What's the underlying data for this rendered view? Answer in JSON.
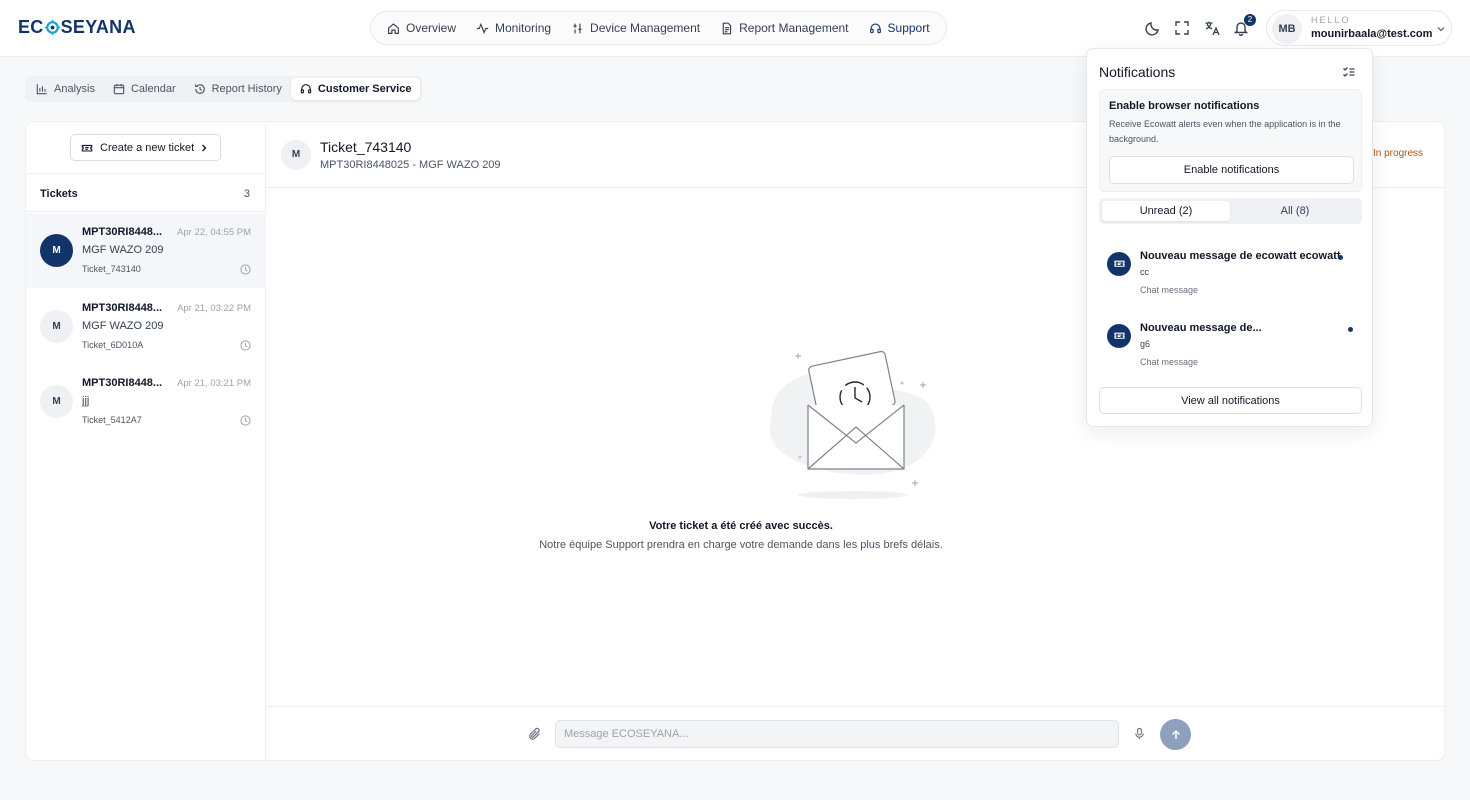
{
  "header": {
    "logo": {
      "part1": "EC",
      "part2": "SEYANA"
    },
    "nav": [
      {
        "label": "Overview",
        "icon": "home-icon"
      },
      {
        "label": "Monitoring",
        "icon": "activity-icon"
      },
      {
        "label": "Device Management",
        "icon": "device-icon"
      },
      {
        "label": "Report Management",
        "icon": "document-icon"
      },
      {
        "label": "Support",
        "icon": "headset-icon"
      }
    ],
    "notification_count": "2",
    "user": {
      "initials": "MB",
      "greeting": "HELLO",
      "email": "mounirbaala@test.com"
    }
  },
  "subtabs": [
    {
      "label": "Analysis",
      "icon": "bar-chart-icon"
    },
    {
      "label": "Calendar",
      "icon": "calendar-icon"
    },
    {
      "label": "Report History",
      "icon": "history-icon"
    },
    {
      "label": "Customer Service",
      "icon": "headset-icon",
      "active": true
    }
  ],
  "sidebar": {
    "create_label": "Create a new ticket",
    "tickets_title": "Tickets",
    "tickets_count": "3",
    "tickets": [
      {
        "initial": "M",
        "title": "MPT30RI8448...",
        "date": "Apr 22, 04:55 PM",
        "subject": "MGF WAZO 209",
        "id": "Ticket_743140",
        "selected": true
      },
      {
        "initial": "M",
        "title": "MPT30RI8448...",
        "date": "Apr 21, 03:22 PM",
        "subject": "MGF WAZO 209",
        "id": "Ticket_6D010A"
      },
      {
        "initial": "M",
        "title": "MPT30RI8448...",
        "date": "Apr 21, 03:21 PM",
        "subject": "jjj",
        "id": "Ticket_5412A7"
      }
    ]
  },
  "chat": {
    "avatar": "M",
    "title": "Ticket_743140",
    "subtitle": "MPT30RI8448025 - MGF WAZO 209",
    "status": "In progress",
    "status_color": "#b45309",
    "empty_title": "Votre ticket a été créé avec succès.",
    "empty_subtitle": "Notre équipe Support prendra en charge votre demande dans les plus brefs délais.",
    "input_placeholder": "Message ECOSEYANA..."
  },
  "notifications": {
    "title": "Notifications",
    "enable_title": "Enable browser notifications",
    "enable_desc": "Receive Ecowatt alerts even when the application is in the background.",
    "enable_button": "Enable notifications",
    "tab_unread": "Unread (2)",
    "tab_all": "All (8)",
    "items": [
      {
        "title": "Nouveau message de ecowatt ecowatt",
        "body": "cc",
        "type": "Chat message"
      },
      {
        "title": "Nouveau message de...",
        "body": "g6",
        "type": "Chat message"
      }
    ],
    "view_all": "View all notifications"
  },
  "colors": {
    "brand": "#13346b",
    "send_button": "#8ea0bd"
  }
}
